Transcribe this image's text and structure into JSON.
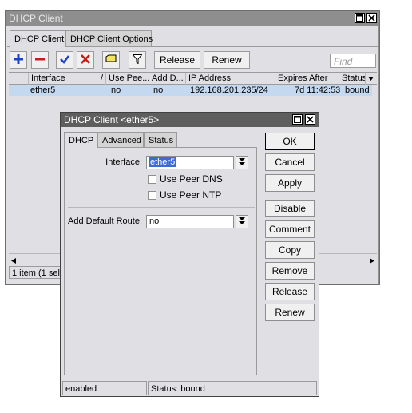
{
  "main_window": {
    "title": "DHCP Client",
    "tabs": [
      {
        "label": "DHCP Client"
      },
      {
        "label": "DHCP Client Options"
      }
    ],
    "toolbar": {
      "icons": [
        "add-icon",
        "remove-icon",
        "enable-icon",
        "disable-icon",
        "comment-icon",
        "filter-icon"
      ],
      "release_label": "Release",
      "renew_label": "Renew",
      "find_placeholder": "Find"
    },
    "table": {
      "columns": [
        "Interface",
        "/",
        "Use Pee...",
        "Add D...",
        "IP Address",
        "Expires After",
        "Status"
      ],
      "rows": [
        {
          "interface": "ether5",
          "use_peer": "no",
          "add_default": "no",
          "ip": "192.168.201.235/24",
          "expires": "7d 11:42:53",
          "status": "bound"
        }
      ]
    },
    "status_bar": "1 item (1 sele"
  },
  "dialog": {
    "title": "DHCP Client <ether5>",
    "tabs": [
      {
        "label": "DHCP"
      },
      {
        "label": "Advanced"
      },
      {
        "label": "Status"
      }
    ],
    "fields": {
      "interface_label": "Interface:",
      "interface_value": "ether5",
      "use_peer_dns_label": "Use Peer DNS",
      "use_peer_ntp_label": "Use Peer NTP",
      "add_default_route_label": "Add Default Route:",
      "add_default_route_value": "no"
    },
    "buttons": [
      "OK",
      "Cancel",
      "Apply",
      "Disable",
      "Comment",
      "Copy",
      "Remove",
      "Release",
      "Renew"
    ],
    "status_left": "enabled",
    "status_right": "Status: bound"
  },
  "colors": {
    "title_active": "#5e5e5e",
    "title_inactive": "#8e8e8e",
    "selection": "#c4d8ef",
    "add_icon": "#1b44c8",
    "remove_icon": "#c81b1b",
    "check_icon": "#1b44c8",
    "x_icon": "#c81b1b"
  }
}
